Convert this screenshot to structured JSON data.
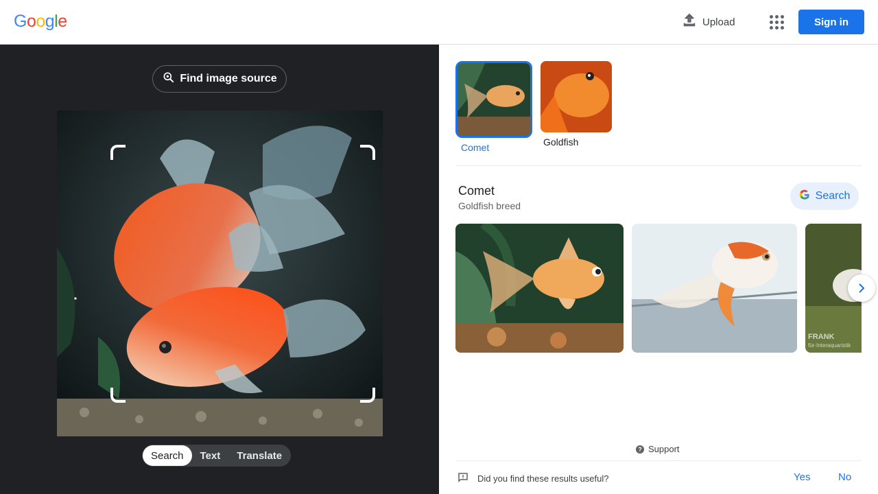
{
  "header": {
    "logo": [
      "G",
      "o",
      "o",
      "g",
      "l",
      "e"
    ],
    "logo_colors": [
      "#4285f4",
      "#ea4335",
      "#fbbc05",
      "#4285f4",
      "#34a853",
      "#ea4335"
    ],
    "upload_label": "Upload",
    "apps_icon": "apps-grid-icon",
    "signin_label": "Sign in"
  },
  "left": {
    "find_source_label": "Find image source",
    "tabs": [
      {
        "label": "Search",
        "active": true
      },
      {
        "label": "Text",
        "active": false
      },
      {
        "label": "Translate",
        "active": false
      }
    ]
  },
  "right": {
    "suggestions": [
      {
        "label": "Comet",
        "selected": true
      },
      {
        "label": "Goldfish",
        "selected": false
      }
    ],
    "entity": {
      "title": "Comet",
      "subtitle": "Goldfish breed",
      "search_label": "Search"
    },
    "result_watermark": "FRANK",
    "result_watermark2": "für-Interaquaristik",
    "support_label": "Support",
    "feedback": {
      "question": "Did you find these results useful?",
      "yes": "Yes",
      "no": "No"
    }
  },
  "colors": {
    "accent": "#1a73e8",
    "left_bg": "#202124",
    "chip_bg": "#e8f0fe"
  }
}
